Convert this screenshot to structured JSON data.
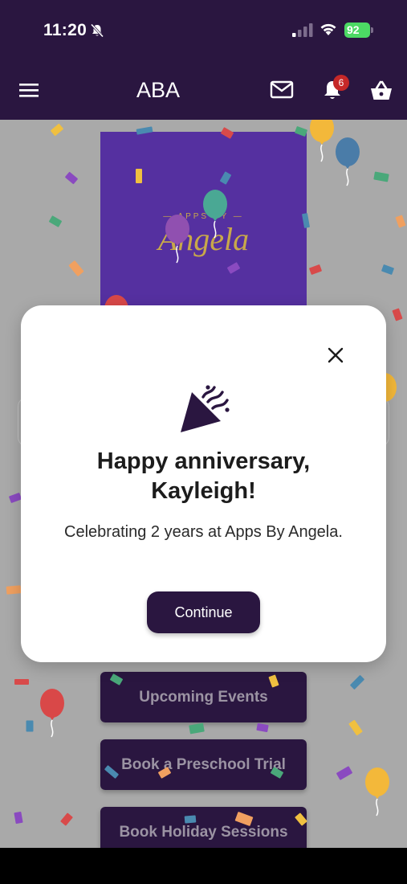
{
  "status_bar": {
    "time": "11:20",
    "battery": "92"
  },
  "app_bar": {
    "title": "ABA",
    "notification_count": "6"
  },
  "logo": {
    "top_text": "— APPS BY —",
    "script_text": "Angela"
  },
  "menu": {
    "items": [
      "Upcoming Events",
      "Book a Preschool Trial",
      "Book Holiday Sessions"
    ]
  },
  "modal": {
    "title_line1": "Happy anniversary,",
    "title_line2": "Kayleigh!",
    "message": "Celebrating 2 years at Apps By Angela.",
    "continue_label": "Continue"
  },
  "colors": {
    "brand": "#2a1640",
    "logo_bg": "#5530a0",
    "overlay": "#a9a9a9",
    "badge": "#c62828"
  }
}
